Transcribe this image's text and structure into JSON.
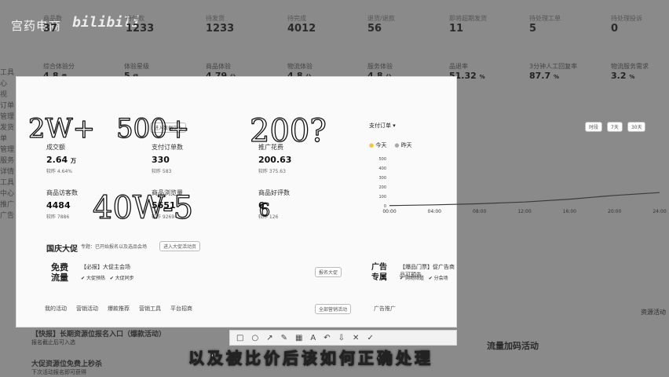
{
  "brand": {
    "name": "宫药电商",
    "bili": "bilibili"
  },
  "top_stats": [
    {
      "label": "商品数",
      "value": "37"
    },
    {
      "label": "待付款",
      "value": "1233"
    },
    {
      "label": "待发货",
      "value": "1233"
    },
    {
      "label": "待完成",
      "value": "4012"
    },
    {
      "label": "退货/退款",
      "value": "56"
    },
    {
      "label": "即将超期发货",
      "value": "11"
    },
    {
      "label": "待处理工单",
      "value": "5"
    },
    {
      "label": "待处理投诉",
      "value": "0"
    }
  ],
  "row2_stats": [
    {
      "label": "综合体验分",
      "value": "4.8",
      "unit": "星"
    },
    {
      "label": "体验星级",
      "value": "5",
      "unit": "级"
    },
    {
      "label": "商品体验",
      "value": "4.79",
      "unit": "分"
    },
    {
      "label": "物流体验",
      "value": "4.8",
      "unit": "分"
    },
    {
      "label": "服务体验",
      "value": "4.8",
      "unit": "分"
    },
    {
      "label": "品退率",
      "value": "51.32",
      "unit": "%"
    },
    {
      "label": "3分钟人工回复率",
      "value": "87.7",
      "unit": "%"
    },
    {
      "label": "物流服务需求",
      "value": "3.2",
      "unit": "%"
    }
  ],
  "panel": {
    "metrics": [
      {
        "label": "成交额",
        "value": "2.64",
        "unit": "万",
        "sub": "较昨 4.64%"
      },
      {
        "label": "支付订单数",
        "value": "330",
        "sub": "较昨 583"
      },
      {
        "label": "推广花费",
        "value": "200.63",
        "sub": "较昨 375.63"
      },
      {
        "label": "商品访客数",
        "value": "4484",
        "sub": "较昨 7886"
      },
      {
        "label": "商品浏览量",
        "value": "5651",
        "sub": "较昨 9269"
      },
      {
        "label": "商品好评数",
        "value": "6",
        "sub": "较昨 126"
      }
    ],
    "view_button": "进入数据中心",
    "promo_title": "国庆大促",
    "promo_note": "专题：已开始报名以及选品会场",
    "promo_button": "进入大促活动页",
    "free_traffic": {
      "title1": "免费",
      "title2": "流量",
      "item": "【必报】大促主会场",
      "check1": "大促预热",
      "check2": "大促同步"
    },
    "report_button": "报名大促",
    "ad": {
      "title1": "广告",
      "title2": "专属",
      "item": "【爆品门票】促广告商品可预告",
      "check1": "购物频道",
      "check2": "分会场"
    },
    "tabs": [
      "我的活动",
      "营销活动",
      "爆款推荐",
      "营销工具",
      "平台招商"
    ],
    "more_button": "全部营销活动",
    "ad_link": "广告推广"
  },
  "chart_data": {
    "type": "line",
    "title": "",
    "legend": [
      {
        "name": "今天",
        "color": "#f5c431"
      },
      {
        "name": "昨天",
        "color": "#aaaaaa"
      }
    ],
    "filter": "支付订单",
    "x": [
      "00:00",
      "04:00",
      "08:00",
      "12:00",
      "16:00",
      "20:00",
      "24:00"
    ],
    "yticks": [
      0,
      100,
      200,
      300,
      400,
      500
    ],
    "series": [
      {
        "name": "今天",
        "values": [
          2,
          10,
          22,
          40,
          70,
          110,
          140
        ]
      }
    ],
    "ylim": [
      0,
      500
    ],
    "range_buttons": [
      "时段",
      "7天",
      "30天"
    ]
  },
  "toolbar_icons": [
    "rect-icon",
    "circle-icon",
    "arrow-icon",
    "pen-icon",
    "mosaic-icon",
    "text-icon",
    "undo-icon",
    "save-icon",
    "close-icon",
    "done-icon"
  ],
  "bottom_items": [
    {
      "title": "【快报】长期资源位报名入口（爆款活动）",
      "sub": "报名截止后可入选"
    },
    {
      "title": "大促资源位免费上秒杀",
      "sub": "下次活动报名即可获得"
    }
  ],
  "right_bottom_text": "资源活动",
  "right_bottom_sub": "流量加码活动",
  "subtitle": "以及被比价后该如何正确处理",
  "handwriting": [
    "2W+",
    "500+",
    "200?",
    "40W-5",
    "6"
  ]
}
